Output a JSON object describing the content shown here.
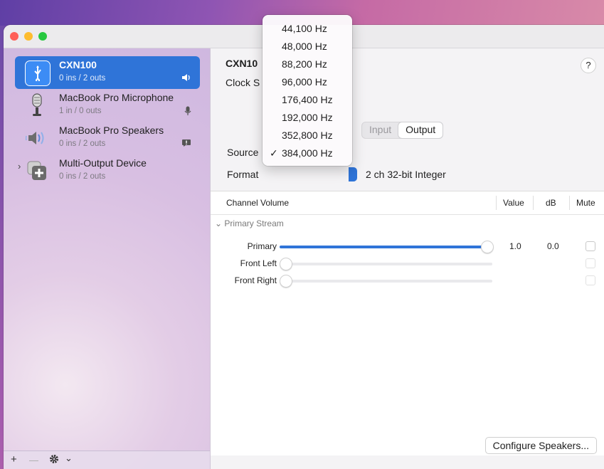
{
  "sidebar": {
    "devices": [
      {
        "name": "CXN100",
        "io": "0 ins / 2 outs",
        "icon": "usb-icon",
        "badge": "speaker-badge-icon"
      },
      {
        "name": "MacBook Pro Microphone",
        "io": "1 in / 0 outs",
        "icon": "microphone-icon",
        "badge": "microphone-badge-icon"
      },
      {
        "name": "MacBook Pro Speakers",
        "io": "0 ins / 2 outs",
        "icon": "speaker-icon",
        "badge": "alert-badge-icon"
      },
      {
        "name": "Multi-Output Device",
        "io": "0 ins / 2 outs",
        "icon": "multi-output-icon"
      }
    ],
    "footer": {
      "add": "+",
      "remove": "—",
      "chevron": "⌄"
    }
  },
  "content": {
    "title": "CXN10",
    "clock_label": "Clock S",
    "help": "?",
    "tabs": [
      "Input",
      "Output"
    ],
    "active_tab": "Output",
    "source_label": "Source",
    "format_label": "Format",
    "format_value": "2 ch 32-bit Integer"
  },
  "table": {
    "headers": {
      "channel": "Channel Volume",
      "value": "Value",
      "db": "dB",
      "mute": "Mute"
    },
    "group": "Primary Stream",
    "rows": [
      {
        "label": "Primary",
        "value": "1.0",
        "db": "0.0",
        "level": 1.0
      },
      {
        "label": "Front Left",
        "value": "",
        "db": "",
        "level": 0.0
      },
      {
        "label": "Front Right",
        "value": "",
        "db": "",
        "level": 0.0
      }
    ]
  },
  "configure_button": "Configure Speakers...",
  "sample_rate_menu": {
    "items": [
      "44,100 Hz",
      "48,000 Hz",
      "88,200 Hz",
      "96,000 Hz",
      "176,400 Hz",
      "192,000 Hz",
      "352,800 Hz",
      "384,000 Hz"
    ],
    "selected": "384,000 Hz",
    "check": "✓"
  },
  "colors": {
    "accent": "#2f74d8"
  }
}
